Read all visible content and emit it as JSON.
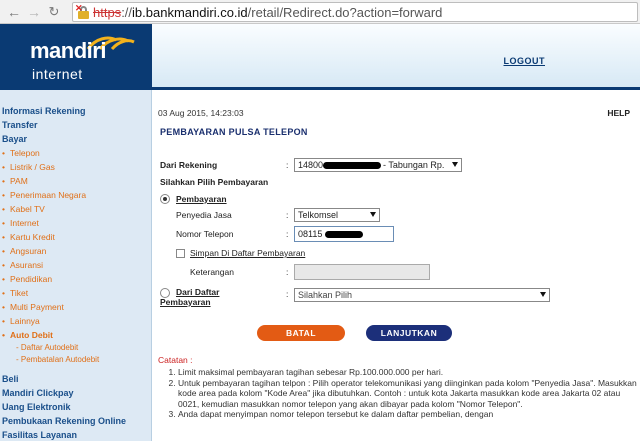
{
  "browser": {
    "url_scheme": "https",
    "url_host": "ib.bankmandiri.co.id",
    "url_path": "/retail/Redirect.do?action=forward"
  },
  "header": {
    "brand": "mandiri",
    "brand_sub": "internet",
    "logout_label": "LOGOUT",
    "brand_color": "#0a3a73",
    "accent_color": "#e07018"
  },
  "sidebar": {
    "groups": [
      {
        "label": "Informasi Rekening"
      },
      {
        "label": "Transfer"
      },
      {
        "label": "Bayar"
      }
    ],
    "bayar_items": [
      "Telepon",
      "Listrik / Gas",
      "PAM",
      "Penerimaan Negara",
      "Kabel TV",
      "Internet",
      "Kartu Kredit",
      "Angsuran",
      "Asuransi",
      "Pendidikan",
      "Tiket",
      "Multi Payment",
      "Lainnya"
    ],
    "auto_debit": "Auto Debit",
    "auto_debit_items": [
      "Daftar Autodebit",
      "Pembatalan Autodebit"
    ],
    "bottom_groups": [
      "Beli",
      "Mandiri Clickpay",
      "Uang Elektronik",
      "Pembukaan Rekening Online",
      "Fasilitas Layanan"
    ]
  },
  "main": {
    "datetime": "03 Aug 2015, 14:23:03",
    "help": "HELP",
    "title": "PEMBAYARAN PULSA TELEPON",
    "dari_rekening_label": "Dari Rekening",
    "colon": ":",
    "dari_rekening_value": "14800",
    "dari_rekening_suffix": "- Tabungan Rp.",
    "silahkan_pilih": "Silahkan Pilih Pembayaran",
    "pembayaran_label": "Pembayaran",
    "penyedia_label": "Penyedia Jasa",
    "penyedia_value": "Telkomsel",
    "nomor_label": "Nomor Telepon",
    "nomor_value": "08115",
    "simpan_label": "Simpan Di Daftar Pembayaran",
    "keterangan_label": "Keterangan",
    "dari_daftar_label_1": "Dari Daftar",
    "dari_daftar_label_2": "Pembayaran",
    "dari_daftar_value": "Silahkan Pilih",
    "batal_label": "BATAL",
    "lanjutkan_label": "LANJUTKAN"
  },
  "notes": {
    "heading": "Catatan :",
    "items": [
      "Limit maksimal pembayaran tagihan sebesar Rp.100.000.000 per hari.",
      "Untuk pembayaran tagihan telpon : Pilih operator telekomunikasi yang diinginkan pada kolom \"Penyedia Jasa\". Masukkan kode area pada kolom \"Kode Area\" jika dibutuhkan. Contoh : untuk kota Jakarta masukkan kode area Jakarta 02 atau 0021, kemudian masukkan nomor telepon yang akan dibayar pada kolom \"Nomor Telepon\".",
      "Anda dapat menyimpan nomor telepon tersebut ke dalam daftar pembelian, dengan"
    ]
  }
}
